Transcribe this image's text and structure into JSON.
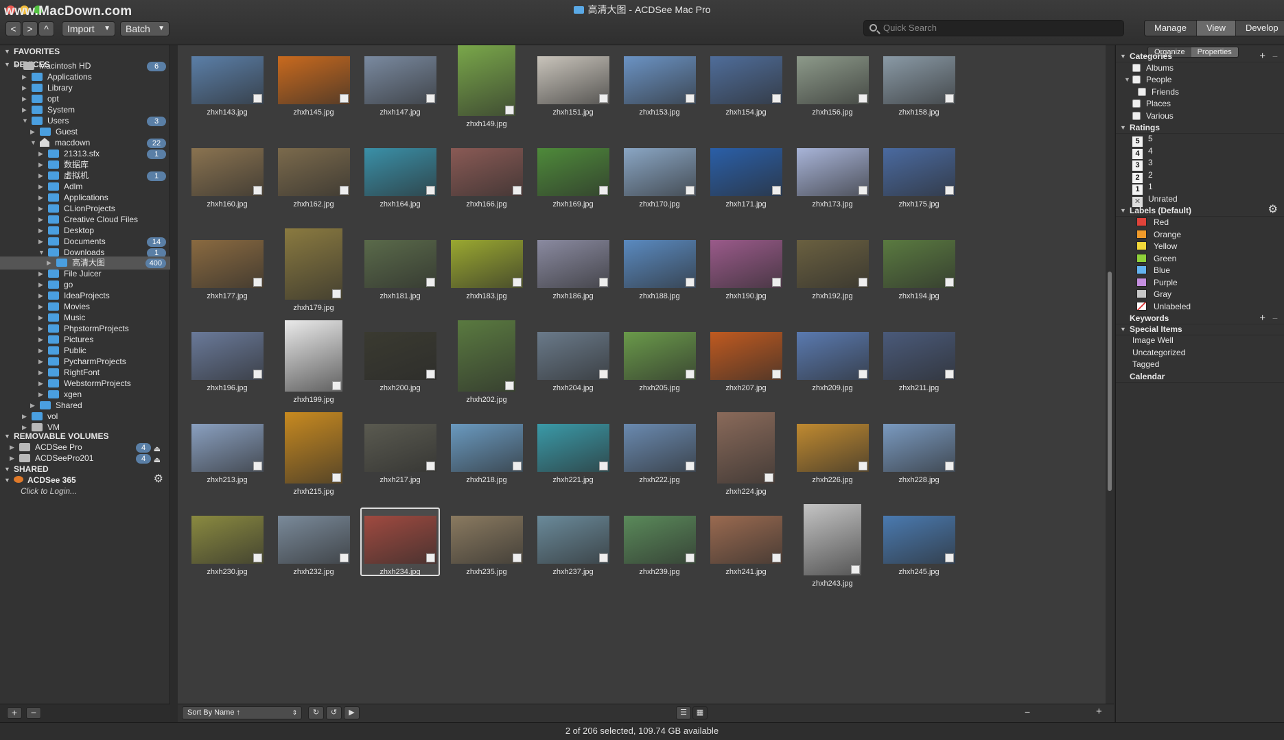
{
  "window": {
    "title": "高清大图 - ACDSee Mac Pro",
    "watermark": "www.MacDown.com"
  },
  "toolbar": {
    "back": "<",
    "forward": ">",
    "up": "^",
    "import_label": "Import",
    "batch_label": "Batch",
    "caret": "▼"
  },
  "search": {
    "placeholder": "Quick Search"
  },
  "modes": {
    "manage": "Manage",
    "view": "View",
    "develop": "Develop"
  },
  "sidebar": {
    "favorites": "FAVORITES",
    "devices": "DEVICES",
    "tree": [
      {
        "label": "Macintosh HD",
        "count": "6"
      },
      {
        "label": "Applications"
      },
      {
        "label": "Library"
      },
      {
        "label": "opt"
      },
      {
        "label": "System"
      },
      {
        "label": "Users",
        "count": "3"
      },
      {
        "label": "Guest"
      },
      {
        "label": "macdown",
        "count": "22"
      },
      {
        "label": "21313.sfx",
        "count": "1"
      },
      {
        "label": "数据库"
      },
      {
        "label": "虚拟机",
        "count": "1"
      },
      {
        "label": "Adlm"
      },
      {
        "label": "Applications"
      },
      {
        "label": "CLionProjects"
      },
      {
        "label": "Creative Cloud Files"
      },
      {
        "label": "Desktop"
      },
      {
        "label": "Documents",
        "count": "14"
      },
      {
        "label": "Downloads",
        "count": "1"
      },
      {
        "label": "高清大图",
        "count": "400"
      },
      {
        "label": "File Juicer"
      },
      {
        "label": "go"
      },
      {
        "label": "IdeaProjects"
      },
      {
        "label": "Movies"
      },
      {
        "label": "Music"
      },
      {
        "label": "PhpstormProjects"
      },
      {
        "label": "Pictures"
      },
      {
        "label": "Public"
      },
      {
        "label": "PycharmProjects"
      },
      {
        "label": "RightFont"
      },
      {
        "label": "WebstormProjects"
      },
      {
        "label": "xgen"
      },
      {
        "label": "Shared"
      },
      {
        "label": "vol"
      },
      {
        "label": "VM"
      }
    ],
    "removable": "REMOVABLE VOLUMES",
    "volumes": [
      {
        "label": "ACDSee Pro",
        "count": "4"
      },
      {
        "label": "ACDSeePro201",
        "count": "4"
      }
    ],
    "shared": "SHARED",
    "acdsee365": "ACDSee 365",
    "login": "Click to Login...",
    "add": "+",
    "remove": "−"
  },
  "grid": {
    "rows": [
      [
        "zhxh143.jpg",
        "zhxh145.jpg",
        "zhxh147.jpg",
        "zhxh149.jpg",
        "zhxh151.jpg",
        "zhxh153.jpg",
        "zhxh154.jpg",
        "zhxh156.jpg",
        "zhxh158.jpg"
      ],
      [
        "zhxh160.jpg",
        "zhxh162.jpg",
        "zhxh164.jpg",
        "zhxh166.jpg",
        "zhxh169.jpg",
        "zhxh170.jpg",
        "zhxh171.jpg",
        "zhxh173.jpg",
        "zhxh175.jpg"
      ],
      [
        "zhxh177.jpg",
        "zhxh179.jpg",
        "zhxh181.jpg",
        "zhxh183.jpg",
        "zhxh186.jpg",
        "zhxh188.jpg",
        "zhxh190.jpg",
        "zhxh192.jpg",
        "zhxh194.jpg"
      ],
      [
        "zhxh196.jpg",
        "zhxh199.jpg",
        "zhxh200.jpg",
        "zhxh202.jpg",
        "zhxh204.jpg",
        "zhxh205.jpg",
        "zhxh207.jpg",
        "zhxh209.jpg",
        "zhxh211.jpg"
      ],
      [
        "zhxh213.jpg",
        "zhxh215.jpg",
        "zhxh217.jpg",
        "zhxh218.jpg",
        "zhxh221.jpg",
        "zhxh222.jpg",
        "zhxh224.jpg",
        "zhxh226.jpg",
        "zhxh228.jpg"
      ],
      [
        "zhxh230.jpg",
        "zhxh232.jpg",
        "zhxh234.jpg",
        "zhxh235.jpg",
        "zhxh237.jpg",
        "zhxh239.jpg",
        "zhxh241.jpg",
        "zhxh243.jpg",
        "zhxh245.jpg"
      ]
    ],
    "portrait": [
      "zhxh149.jpg",
      "zhxh179.jpg",
      "zhxh199.jpg",
      "zhxh202.jpg",
      "zhxh215.jpg",
      "zhxh224.jpg",
      "zhxh243.jpg"
    ],
    "selected": "zhxh234.jpg",
    "colors": [
      "#5b7fa8",
      "#c96a1e",
      "#7a8aa0",
      "#7aa84a",
      "#c9c4bb",
      "#6b93c4",
      "#4f6d9a",
      "#8d9a8a",
      "#8a9aa6",
      "#8a7350",
      "#7b6a4c",
      "#3a90a8",
      "#8a5a55",
      "#4e8a3a",
      "#8aa6c4",
      "#2a5fa8",
      "#a8b4d8",
      "#4a6aa0",
      "#8a6a40",
      "#8a7a40",
      "#5a6a4a",
      "#9aa830",
      "#8a8aa0",
      "#5a8ac0",
      "#9a5a8a",
      "#6a6040",
      "#5a7a40",
      "#6a7a9a",
      "#eaeaea",
      "#3a3a30",
      "#5a7a40",
      "#6a7a8a",
      "#6a9a4a",
      "#c05a20",
      "#5a7ab0",
      "#4a5a7a",
      "#8aa0c0",
      "#c88a20",
      "#5a5a50",
      "#6a9ac0",
      "#3a9aa8",
      "#6a8ab0",
      "#8a6a5a",
      "#c08a30",
      "#7a9ac0",
      "#8a8a40",
      "#7a8a9a",
      "#a04a40",
      "#8a7a60",
      "#6a8a9a",
      "#5a8a5a",
      "#9a6a50",
      "#c4c4c4",
      "#4a7ab0"
    ]
  },
  "gridbar": {
    "sort": "Sort By Name ↑",
    "zoom_fraction": 0.33
  },
  "status": "2 of 206 selected, 109.74 GB available",
  "right": {
    "tabs": {
      "organize": "Organize",
      "properties": "Properties"
    },
    "categories": {
      "title": "Categories",
      "items": [
        "Albums",
        "People",
        "Friends",
        "Places",
        "Various"
      ]
    },
    "ratings": {
      "title": "Ratings",
      "items": [
        {
          "n": "5",
          "label": "5"
        },
        {
          "n": "4",
          "label": "4"
        },
        {
          "n": "3",
          "label": "3"
        },
        {
          "n": "2",
          "label": "2"
        },
        {
          "n": "1",
          "label": "1"
        }
      ],
      "unrated": "Unrated"
    },
    "labels": {
      "title": "Labels (Default)",
      "items": [
        {
          "label": "Red",
          "color": "#e0433a"
        },
        {
          "label": "Orange",
          "color": "#f09a2a"
        },
        {
          "label": "Yellow",
          "color": "#f2d83a"
        },
        {
          "label": "Green",
          "color": "#8fd13a"
        },
        {
          "label": "Blue",
          "color": "#63b3f0"
        },
        {
          "label": "Purple",
          "color": "#c58fe0"
        },
        {
          "label": "Gray",
          "color": "#c9c9c9"
        },
        {
          "label": "Unlabeled",
          "color": "#ffffff"
        }
      ]
    },
    "keywords": {
      "title": "Keywords"
    },
    "special": {
      "title": "Special Items",
      "items": [
        "Image Well",
        "Uncategorized",
        "Tagged"
      ]
    },
    "calendar": {
      "title": "Calendar"
    }
  }
}
